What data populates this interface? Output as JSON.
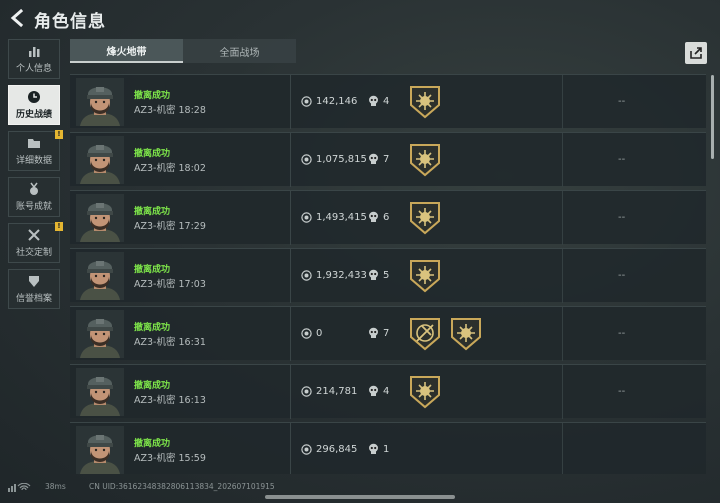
{
  "header": {
    "title": "角色信息",
    "back_icon": "back-arrow-icon"
  },
  "sidebar": {
    "items": [
      {
        "label": "个人信息",
        "icon": "bar-chart-icon",
        "active": false,
        "alert": ""
      },
      {
        "label": "历史战绩",
        "icon": "clock-icon",
        "active": true,
        "alert": ""
      },
      {
        "label": "详细数据",
        "icon": "folder-icon",
        "active": false,
        "alert": "!"
      },
      {
        "label": "账号成就",
        "icon": "medal-icon",
        "active": false,
        "alert": ""
      },
      {
        "label": "社交定制",
        "icon": "tools-icon",
        "active": false,
        "alert": "!"
      },
      {
        "label": "信誉档案",
        "icon": "shield-icon",
        "active": false,
        "alert": ""
      }
    ]
  },
  "tabs": [
    {
      "label": "烽火地带",
      "active": true
    },
    {
      "label": "全面战场",
      "active": false
    }
  ],
  "share_icon": "share-icon",
  "records": [
    {
      "status": "撤离成功",
      "map": "AZ3-机密",
      "time": "18:28",
      "value": "142,146",
      "kills": "4",
      "badges": 1,
      "extra": "--"
    },
    {
      "status": "撤离成功",
      "map": "AZ3-机密",
      "time": "18:02",
      "value": "1,075,815",
      "kills": "7",
      "badges": 1,
      "extra": "--"
    },
    {
      "status": "撤离成功",
      "map": "AZ3-机密",
      "time": "17:29",
      "value": "1,493,415",
      "kills": "6",
      "badges": 1,
      "extra": "--"
    },
    {
      "status": "撤离成功",
      "map": "AZ3-机密",
      "time": "17:03",
      "value": "1,932,433",
      "kills": "5",
      "badges": 1,
      "extra": "--"
    },
    {
      "status": "撤离成功",
      "map": "AZ3-机密",
      "time": "16:31",
      "value": "0",
      "kills": "7",
      "badges": 2,
      "extra": "--"
    },
    {
      "status": "撤离成功",
      "map": "AZ3-机密",
      "time": "16:13",
      "value": "214,781",
      "kills": "4",
      "badges": 1,
      "extra": "--"
    },
    {
      "status": "撤离成功",
      "map": "AZ3-机密",
      "time": "15:59",
      "value": "296,845",
      "kills": "1",
      "badges": 0,
      "extra": ""
    }
  ],
  "footer": {
    "ping": "38ms",
    "uid": "CN UID:36162348382806113834_202607101915"
  },
  "colors": {
    "success": "#7ee64a",
    "alert": "#e5b631",
    "badge_gold": "#c9a85a"
  }
}
